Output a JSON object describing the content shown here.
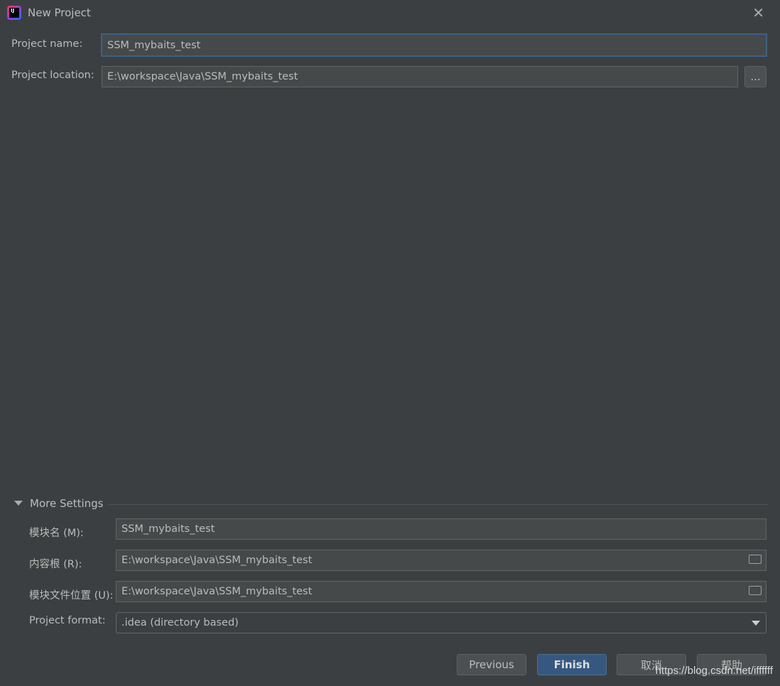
{
  "window": {
    "title": "New Project",
    "close": "✕"
  },
  "project": {
    "name_label": "Project name:",
    "name_value": "SSM_mybaits_test",
    "location_label": "Project location:",
    "location_value": "E:\\workspace\\Java\\SSM_mybaits_test",
    "browse_label": "..."
  },
  "more_settings": {
    "title": "More Settings",
    "module_name_label": "模块名 (M):",
    "module_name_value": "SSM_mybaits_test",
    "content_root_label": "内容根 (R):",
    "content_root_value": "E:\\workspace\\Java\\SSM_mybaits_test",
    "module_file_label": "模块文件位置 (U):",
    "module_file_value": "E:\\workspace\\Java\\SSM_mybaits_test",
    "format_label": "Project format:",
    "format_value": ".idea (directory based)"
  },
  "buttons": {
    "previous": "Previous",
    "finish": "Finish",
    "cancel": "取消",
    "help": "帮助"
  },
  "watermark": "https://blog.csdn.net/iffffff"
}
